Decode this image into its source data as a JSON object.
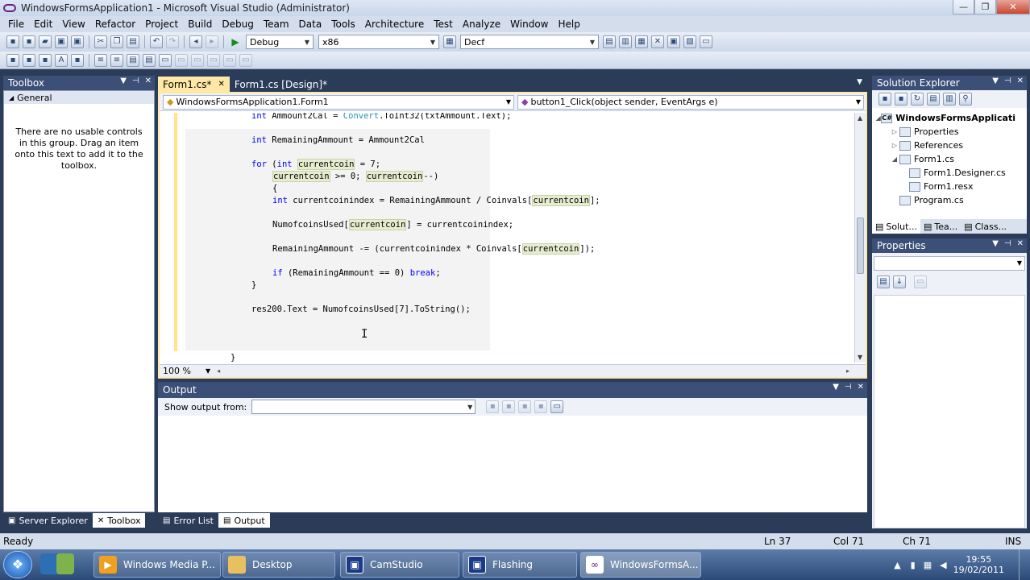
{
  "window": {
    "title": "WindowsFormsApplication1 - Microsoft Visual Studio (Administrator)"
  },
  "menu": [
    "File",
    "Edit",
    "View",
    "Refactor",
    "Project",
    "Build",
    "Debug",
    "Team",
    "Data",
    "Tools",
    "Architecture",
    "Test",
    "Analyze",
    "Window",
    "Help"
  ],
  "toolbar": {
    "config": "Debug",
    "platform": "x86",
    "find": "Decf"
  },
  "toolbox": {
    "title": "Toolbox",
    "group": "General",
    "message": "There are no usable controls in this group. Drag an item onto this text to add it to the toolbox."
  },
  "left_tabs": [
    "Server Explorer",
    "Toolbox"
  ],
  "doc_tabs": [
    "Form1.cs*",
    "Form1.cs [Design]*"
  ],
  "editor": {
    "type_combo": "WindowsFormsApplication1.Form1",
    "member_combo": "button1_Click(object sender, EventArgs e)",
    "zoom": "100 %",
    "l1": {
      "a": "int",
      "b": " Ammount2Cal = ",
      "c": "Convert",
      "d": ".ToInt32(txtAmmount.Text);"
    },
    "l2": {
      "a": "int",
      "b": " RemainingAmmount = Ammount2Cal"
    },
    "l3": {
      "a": "for",
      "b": " (",
      "c": "int",
      "d": " ",
      "e": "currentcoin",
      "f": " = 7;"
    },
    "l4": {
      "a": "currentcoin",
      "b": " >= 0; ",
      "c": "currentcoin",
      "d": "--)"
    },
    "l5": "{",
    "l6": {
      "a": "int",
      "b": " currentcoinindex = RemainingAmmount / Coinvals[",
      "c": "currentcoin",
      "d": "];"
    },
    "l7": {
      "a": "NumofcoinsUsed[",
      "b": "currentcoin",
      "c": "] = currentcoinindex;"
    },
    "l8": {
      "a": "RemainingAmmount -= (currentcoinindex * Coinvals[",
      "b": "currentcoin",
      "c": "]);"
    },
    "l9": {
      "a": "if",
      "b": " (RemainingAmmount == 0) ",
      "c": "break",
      "d": ";"
    },
    "l10": "}",
    "l11": "res200.Text = NumofcoinsUsed[7].ToString();",
    "l12": "}"
  },
  "output": {
    "title": "Output",
    "label": "Show output from:",
    "selected": ""
  },
  "bottom_tabs": [
    "Error List",
    "Output"
  ],
  "solution": {
    "title": "Solution Explorer",
    "items": [
      "WindowsFormsApplicati",
      "Properties",
      "References",
      "Form1.cs",
      "Form1.Designer.cs",
      "Form1.resx",
      "Program.cs"
    ],
    "tabs": [
      "Solut...",
      "Tea...",
      "Class..."
    ]
  },
  "properties": {
    "title": "Properties"
  },
  "status": {
    "ready": "Ready",
    "ln": "Ln 37",
    "col": "Col 71",
    "ch": "Ch 71",
    "ins": "INS"
  },
  "taskbar": {
    "items": [
      "Windows Media P...",
      "Desktop",
      "CamStudio",
      "Flashing",
      "WindowsFormsA..."
    ],
    "time": "19:55",
    "date": "19/02/2011"
  }
}
